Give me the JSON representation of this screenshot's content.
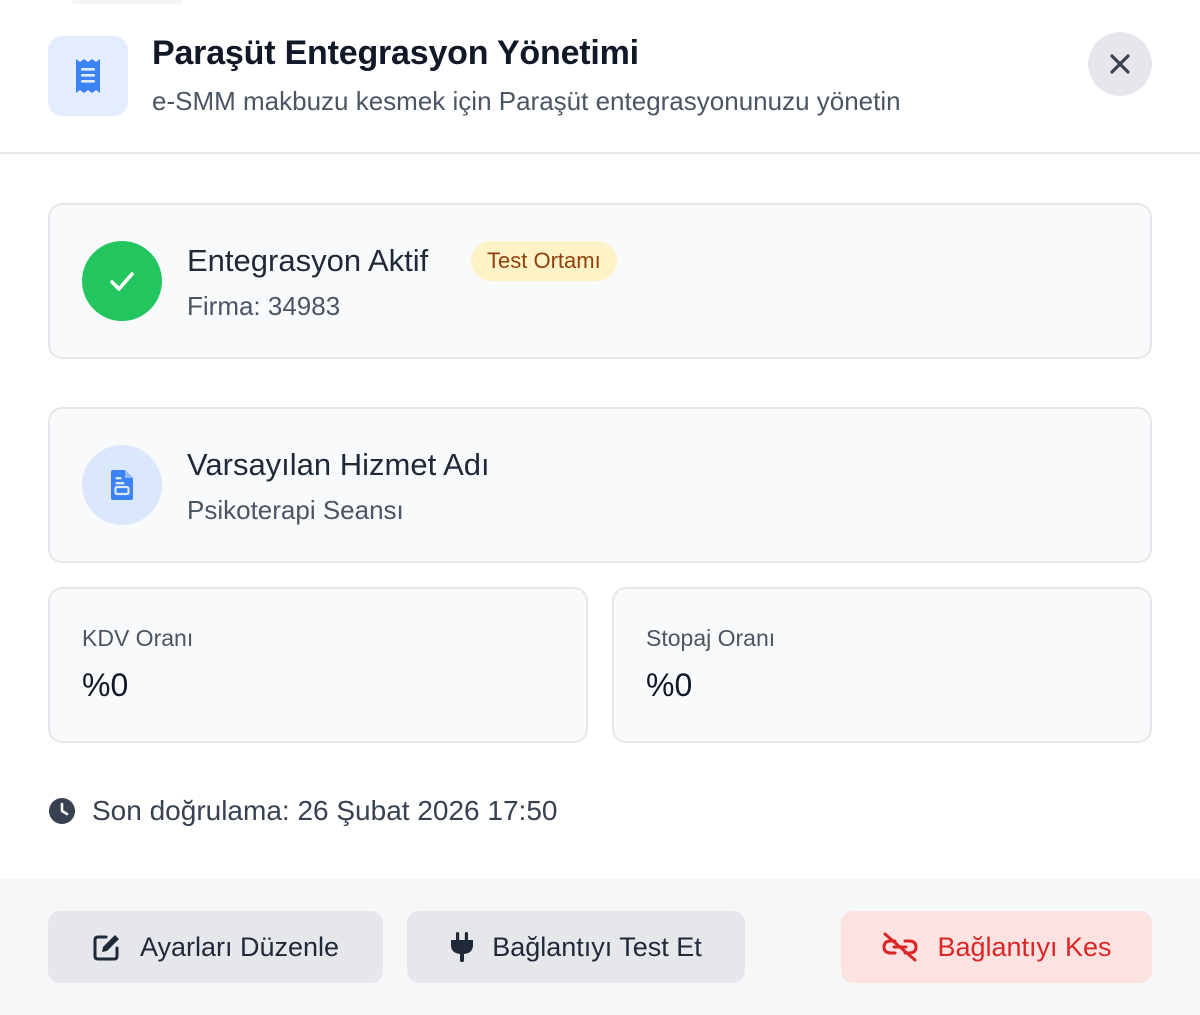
{
  "header": {
    "title": "Paraşüt Entegrasyon Yönetimi",
    "subtitle": "e-SMM makbuzu kesmek için Paraşüt entegrasyonunuzu yönetin",
    "icon": "receipt-icon",
    "close_icon": "close-icon"
  },
  "status": {
    "title": "Entegrasyon Aktif",
    "badge": "Test Ortamı",
    "firma": "Firma: 34983",
    "icon": "check-icon"
  },
  "service": {
    "title": "Varsayılan Hizmet Adı",
    "value": "Psikoterapi Seansı",
    "icon": "document-icon"
  },
  "rates": {
    "kdv_label": "KDV Oranı",
    "kdv_value": "%0",
    "stopaj_label": "Stopaj Oranı",
    "stopaj_value": "%0"
  },
  "verification": {
    "text": "Son doğrulama: 26 Şubat 2026 17:50",
    "icon": "clock-icon"
  },
  "footer": {
    "edit_label": "Ayarları Düzenle",
    "test_label": "Bağlantıyı Test Et",
    "disconnect_label": "Bağlantıyı Kes"
  },
  "colors": {
    "success": "#22c55e",
    "accent_blue": "#3b82f6",
    "danger": "#dc2626",
    "badge_bg": "#fef3c7",
    "badge_text": "#92400e"
  }
}
